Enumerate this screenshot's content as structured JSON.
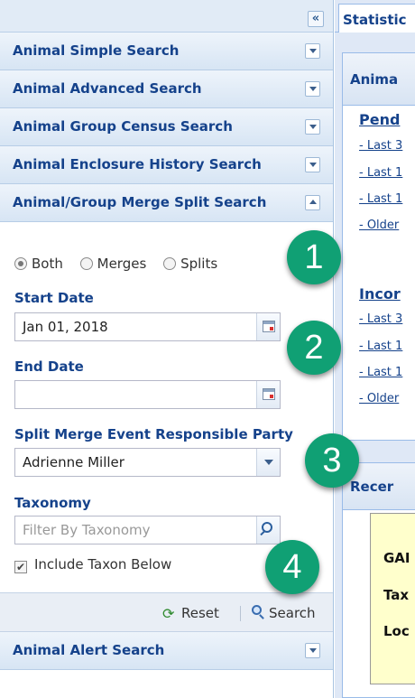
{
  "left_panel": {
    "collapse_glyph": "«",
    "accordion": [
      {
        "label": "Animal Simple Search",
        "state": "collapsed"
      },
      {
        "label": "Animal Advanced Search",
        "state": "collapsed"
      },
      {
        "label": "Animal Group Census Search",
        "state": "collapsed"
      },
      {
        "label": "Animal Enclosure History Search",
        "state": "collapsed"
      },
      {
        "label": "Animal/Group Merge Split Search",
        "state": "expanded"
      }
    ],
    "merge_split": {
      "radio_options": [
        {
          "label": "Both",
          "selected": true
        },
        {
          "label": "Merges",
          "selected": false
        },
        {
          "label": "Splits",
          "selected": false
        }
      ],
      "start_date_label": "Start Date",
      "start_date_value": "Jan 01, 2018",
      "end_date_label": "End Date",
      "end_date_value": "",
      "party_label": "Split Merge Event Responsible Party",
      "party_value": "Adrienne Miller",
      "taxonomy_label": "Taxonomy",
      "taxonomy_placeholder": "Filter By Taxonomy",
      "include_taxon_label": "Include Taxon Below",
      "include_taxon_checked": true,
      "reset_label": "Reset",
      "search_label": "Search"
    },
    "alert_header": {
      "label": "Animal Alert Search",
      "state": "collapsed"
    }
  },
  "right_panel": {
    "tab_label": "Statistic",
    "panel1_title": "Anima",
    "pending_title": "Pend",
    "pending_links": [
      "- Last 3",
      "- Last 1",
      "- Last 1",
      "- Older"
    ],
    "incoming_title": "Incor",
    "incoming_links": [
      "- Last 3",
      "- Last 1",
      "- Last 1",
      "- Older"
    ],
    "panel2_title": "Recer",
    "card_labels": [
      "GAI",
      "Tax",
      "Loc"
    ]
  },
  "callouts": [
    "1",
    "2",
    "3",
    "4"
  ],
  "colors": {
    "header_text": "#15428b",
    "callout": "#10a074",
    "card_bg": "#ffffcc"
  }
}
